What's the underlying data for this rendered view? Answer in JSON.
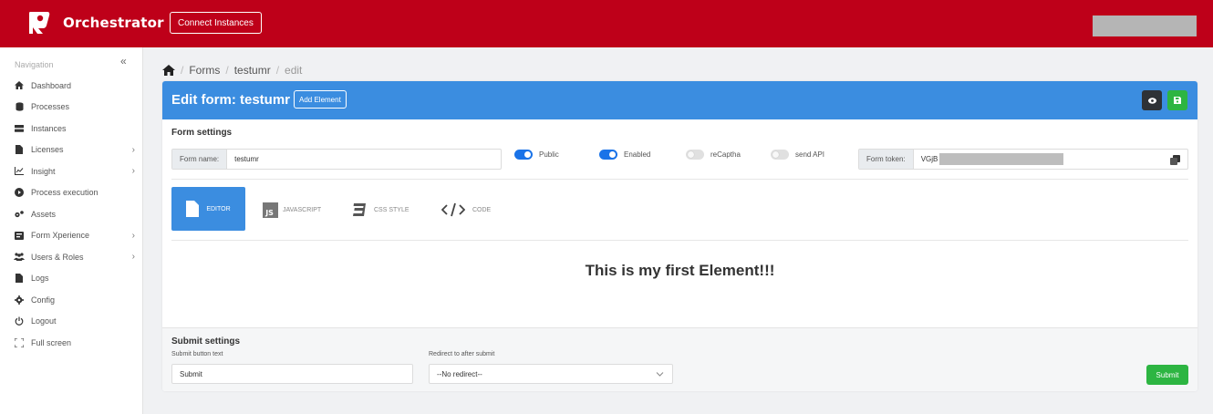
{
  "topbar": {
    "app_name": "Orchestrator",
    "connect_label": "Connect Instances",
    "accent_color": "#be0019"
  },
  "sidebar": {
    "title": "Navigation",
    "collapse_glyph": "«",
    "items": [
      {
        "label": "Dashboard",
        "icon": "home-icon",
        "has_children": false
      },
      {
        "label": "Processes",
        "icon": "database-icon",
        "has_children": false
      },
      {
        "label": "Instances",
        "icon": "server-icon",
        "has_children": false
      },
      {
        "label": "Licenses",
        "icon": "file-icon",
        "has_children": true
      },
      {
        "label": "Insight",
        "icon": "chart-icon",
        "has_children": true
      },
      {
        "label": "Process execution",
        "icon": "play-icon",
        "has_children": false
      },
      {
        "label": "Assets",
        "icon": "cogs-icon",
        "has_children": false
      },
      {
        "label": "Form Xperience",
        "icon": "form-icon",
        "has_children": true
      },
      {
        "label": "Users & Roles",
        "icon": "users-icon",
        "has_children": true
      },
      {
        "label": "Logs",
        "icon": "log-icon",
        "has_children": false
      },
      {
        "label": "Config",
        "icon": "gear-icon",
        "has_children": false
      },
      {
        "label": "Logout",
        "icon": "power-icon",
        "has_children": false
      },
      {
        "label": "Full screen",
        "icon": "fullscreen-icon",
        "has_children": false
      }
    ],
    "chevron_glyph": "›"
  },
  "breadcrumb": {
    "sep": "/",
    "items": [
      "Forms",
      "testumr",
      "edit"
    ]
  },
  "card": {
    "title": "Edit form: testumr",
    "add_element_label": "Add Element",
    "header_color": "#3b8de0"
  },
  "form_settings": {
    "title": "Form settings",
    "form_name_label": "Form name:",
    "form_name_value": "testumr",
    "toggles": [
      {
        "label": "Public",
        "on": true
      },
      {
        "label": "Enabled",
        "on": true
      },
      {
        "label": "reCaptha",
        "on": false
      },
      {
        "label": "send API",
        "on": false
      }
    ],
    "token_label": "Form token:",
    "token_value": "VGjB"
  },
  "tabs": [
    {
      "label": "EDITOR",
      "icon": "file-icon",
      "active": true
    },
    {
      "label": "JAVASCRIPT",
      "icon": "js-icon",
      "active": false
    },
    {
      "label": "CSS STYLE",
      "icon": "css3-icon",
      "active": false
    },
    {
      "label": "CODE",
      "icon": "code-icon",
      "active": false
    }
  ],
  "preview": {
    "text": "This is my first Element!!!"
  },
  "submit_settings": {
    "title": "Submit settings",
    "button_text_label": "Submit button text",
    "button_text_value": "Submit",
    "redirect_label": "Redirect to after submit",
    "redirect_value": "--No redirect--",
    "submit_label": "Submit",
    "submit_color": "#2db542"
  }
}
